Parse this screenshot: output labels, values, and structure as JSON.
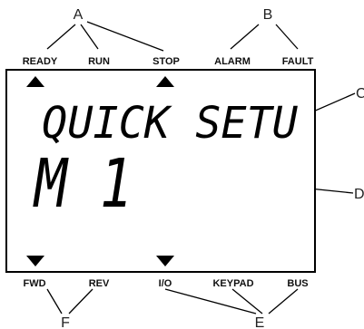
{
  "callouts": {
    "a": "A",
    "b": "B",
    "c": "C",
    "d": "D",
    "e": "E",
    "f": "F"
  },
  "top_indicators": [
    "READY",
    "RUN",
    "STOP",
    "ALARM",
    "FAULT"
  ],
  "bottom_indicators": [
    "FWD",
    "REV",
    "I/O",
    "KEYPAD",
    "BUS"
  ],
  "display": {
    "line1": "QUICK SETU",
    "line2": "M 1"
  },
  "colors": {
    "lcd_border": "#000000",
    "background": "#ffffff"
  }
}
